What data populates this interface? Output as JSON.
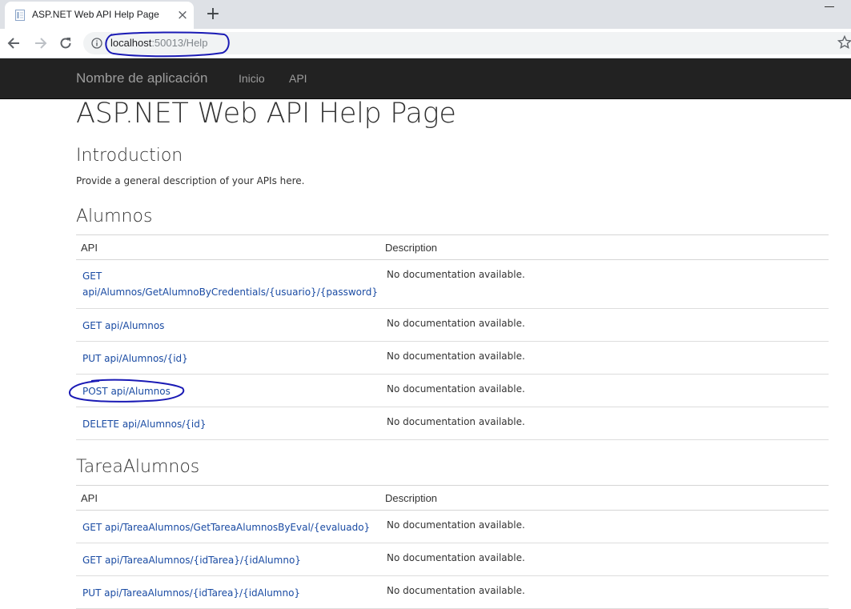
{
  "browser": {
    "tab_title": "ASP.NET Web API Help Page",
    "tab_close": "×",
    "new_tab": "+",
    "url_host": "localhost",
    "url_rest": ":50013/Help"
  },
  "navbar": {
    "brand": "Nombre de aplicación",
    "links": [
      "Inicio",
      "API"
    ]
  },
  "page": {
    "title": "ASP.NET Web API Help Page",
    "intro_heading": "Introduction",
    "intro_text": "Provide a general description of your APIs here."
  },
  "sections": [
    {
      "heading": "Alumnos",
      "col_api": "API",
      "col_desc": "Description",
      "rows": [
        {
          "api": "GET api/Alumnos/GetAlumnoByCredentials/{usuario}/{password}",
          "desc": "No documentation available."
        },
        {
          "api": "GET api/Alumnos",
          "desc": "No documentation available."
        },
        {
          "api": "PUT api/Alumnos/{id}",
          "desc": "No documentation available."
        },
        {
          "api": "POST api/Alumnos",
          "desc": "No documentation available."
        },
        {
          "api": "DELETE api/Alumnos/{id}",
          "desc": "No documentation available."
        }
      ]
    },
    {
      "heading": "TareaAlumnos",
      "col_api": "API",
      "col_desc": "Description",
      "rows": [
        {
          "api": "GET api/TareaAlumnos/GetTareaAlumnosByEval/{evaluado}",
          "desc": "No documentation available."
        },
        {
          "api": "GET api/TareaAlumnos/{idTarea}/{idAlumno}",
          "desc": "No documentation available."
        },
        {
          "api": "PUT api/TareaAlumnos/{idTarea}/{idAlumno}",
          "desc": "No documentation available."
        }
      ]
    }
  ],
  "colors": {
    "navbar_bg": "#222222",
    "link": "#1a4ba3",
    "annotation": "#1a1ab5"
  }
}
